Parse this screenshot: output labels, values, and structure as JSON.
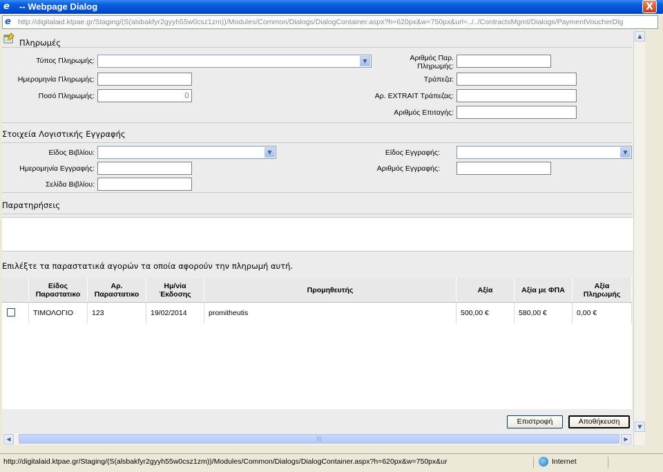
{
  "window": {
    "title": "-- Webpage Dialog",
    "url": "http://digitalaid.ktpae.gr/Staging/(S(alsbakfyr2gyyh55w0csz1zm))/Modules/Common/Dialogs/DialogContainer.aspx?h=620px&w=750px&url=../../ContractsMgmt/Dialogs/PaymentVoucherDlg",
    "close_label": "X"
  },
  "payments": {
    "header": "Πληρωμές",
    "payment_type_label": "Τύπος Πληρωμής:",
    "payment_number_label_1": "Αριθμός Παρ.",
    "payment_number_label_2": "Πληρωμής:",
    "payment_date_label": "Ημερομηνία Πληρωμής:",
    "bank_label": "Τράπεζα:",
    "amount_label": "Ποσό Πληρωμής:",
    "amount_value": "0",
    "extrait_label": "Αρ. EXTRAIT Τράπεζας:",
    "cheque_label": "Αριθμός Επιταγής:"
  },
  "accounting": {
    "header": "Στοιχεία Λογιστικής Εγγραφής",
    "book_type_label": "Είδος Βιβλίου:",
    "entry_type_label": "Είδος Εγγραφής:",
    "entry_date_label": "Ημερομηνία Εγγραφής:",
    "entry_number_label": "Αριθμός Εγγραφής:",
    "book_page_label": "Σελίδα Βιβλίου:"
  },
  "notes": {
    "header": "Παρατηρήσεις"
  },
  "documents": {
    "instruction": "Επιλέξτε τα παραστατικά αγορών τα οποία αφορούν την πληρωμή αυτή.",
    "columns": [
      {
        "l1": "Είδος",
        "l2": "Παραστατικο"
      },
      {
        "l1": "Αρ.",
        "l2": "Παραστατικο"
      },
      {
        "l1": "Ημ/νία",
        "l2": "Έκδοσης"
      },
      {
        "l1": "Προμηθευτής",
        "l2": ""
      },
      {
        "l1": "Αξία",
        "l2": ""
      },
      {
        "l1": "Αξία με ΦΠΑ",
        "l2": ""
      },
      {
        "l1": "Αξία",
        "l2": "Πληρωμής"
      }
    ],
    "rows": [
      {
        "type": "ΤΙΜΟΛΟΓΙΟ",
        "number": "123",
        "date": "19/02/2014",
        "supplier": "promitheutis",
        "value": "500,00 €",
        "value_vat": "580,00 €",
        "paid": "0,00 €"
      }
    ]
  },
  "buttons": {
    "back": "Επιστροφή",
    "save": "Αποθήκευση"
  },
  "status": {
    "text": "http://digitalaid.ktpae.gr/Staging/(S(alsbakfyr2gyyh55w0csz1zm))/Modules/Common/Dialogs/DialogContainer.aspx?h=620px&w=750px&ur",
    "zone": "Internet"
  },
  "colors": {
    "titlebar": "#0550d8",
    "panel": "#ececec"
  }
}
